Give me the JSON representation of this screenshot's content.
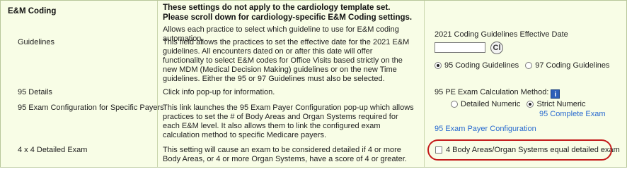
{
  "section": {
    "title": "E&M Coding",
    "notice_line1": "These settings do not apply to the cardiology template set.",
    "notice_line2": "Please scroll down for cardiology-specific E&M Coding settings.",
    "intro": "Allows each practice to select which guideline to use for E&M coding automation."
  },
  "guidelines": {
    "label": "Guidelines",
    "description": "This field allows the practices to set the effective date for the 2021 E&M guidelines. All encounters dated on or after this date will offer functionality to select E&M codes for Office Visits based strictly on the new MDM (Medical Decision Making) guidelines or on the new Time guidelines. Either the 95 or 97 Guidelines must also be selected.",
    "date_label": "2021 Coding Guidelines Effective Date",
    "date_value": "",
    "clear_button": "Cl",
    "option_95": "95 Coding Guidelines",
    "option_97": "97 Coding Guidelines",
    "selected": "95"
  },
  "details_95": {
    "label": "95 Details",
    "description": "Click info pop-up for information.",
    "method_label": "95 PE Exam Calculation Method:",
    "info_icon": "i",
    "option_detailed": "Detailed Numeric",
    "option_strict": "Strict Numeric",
    "selected": "Strict Numeric",
    "complete_exam_link": "95 Complete Exam"
  },
  "exam_config": {
    "label": "95 Exam Configuration for Specific Payers",
    "description": "This link launches the 95 Exam Payer Configuration pop-up which allows practices to set the # of Body Areas and Organ Systems required for each E&M level. It also allows them to link the configured exam calculation method to specific Medicare payers.",
    "link": "95 Exam Payer Configuration"
  },
  "detailed_exam": {
    "label": "4 x 4 Detailed Exam",
    "description": "This setting will cause an exam to be considered detailed if 4 or more Body Areas, or 4 or more Organ Systems, have a score of 4 or greater.",
    "checkbox_label": "4 Body Areas/Organ Systems equal detailed exam",
    "checked": false
  },
  "colors": {
    "background": "#f8fde6",
    "border": "#b8c79a",
    "link": "#2a6bd0",
    "highlight": "#c41b1b"
  }
}
